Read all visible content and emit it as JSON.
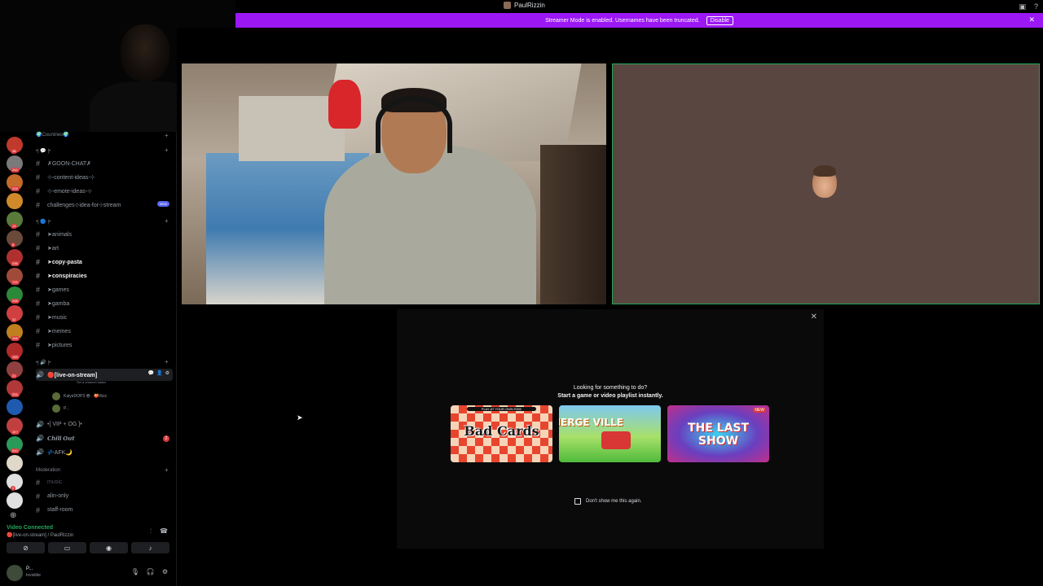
{
  "titlebar": {
    "title": "PaulRizzin"
  },
  "banner": {
    "message": "Streamer Mode is enabled. Usernames have been truncated.",
    "disable_label": "Disable",
    "close_icon": "✕"
  },
  "rail": {
    "servers": [
      {
        "color": "#c0392b",
        "badge": "38"
      },
      {
        "color": "#7a7a7a",
        "badge": "262"
      },
      {
        "color": "#c46a2b",
        "badge": "205"
      },
      {
        "color": "#d08a2a",
        "badge": ""
      },
      {
        "color": "#5a7a3a",
        "badge": "13"
      },
      {
        "color": "#6a4a3a",
        "badge": "8"
      },
      {
        "color": "#b03030",
        "badge": "236"
      },
      {
        "color": "#a04a3a",
        "badge": "729"
      },
      {
        "color": "#2a8a3a",
        "badge": "298"
      },
      {
        "color": "#d04040",
        "badge": "32"
      },
      {
        "color": "#c08020",
        "badge": "398"
      },
      {
        "color": "#b02a2a",
        "badge": "159"
      },
      {
        "color": "#904040",
        "badge": "21"
      },
      {
        "color": "#b03838",
        "badge": "254"
      },
      {
        "color": "#1e5ab0",
        "badge": ""
      },
      {
        "color": "#c04040",
        "badge": "1K+"
      },
      {
        "color": "#2a9a5a",
        "badge": "810"
      },
      {
        "color": "#e0d8c8",
        "badge": ""
      },
      {
        "color": "#e0e0e0",
        "badge": "3"
      },
      {
        "color": "#e0e0e0",
        "badge": ""
      }
    ]
  },
  "sidebar": {
    "categories": {
      "countries": "🌍Countries🌍",
      "chat": "•| 💬 |•",
      "general": "•| 🔵 |•",
      "voice": "•| 🔊 |•",
      "moderation": "Moderation"
    },
    "text_channels": [
      {
        "name": "✗GOON-CHAT✗"
      },
      {
        "name": "⊹-content-ideas-⊹"
      },
      {
        "name": "⊹-emote-ideas-⊹"
      },
      {
        "name": "challenges⊹idea-for⊹stream",
        "badge": "NEW"
      }
    ],
    "general_channels": [
      {
        "name": "➤animals",
        "bright": false
      },
      {
        "name": "➤art",
        "bright": false
      },
      {
        "name": "➤copy-pasta",
        "bright": true
      },
      {
        "name": "➤conspiracies",
        "bright": true
      },
      {
        "name": "➤games",
        "bright": false
      },
      {
        "name": "➤gamba",
        "bright": false
      },
      {
        "name": "➤music",
        "bright": false
      },
      {
        "name": "➤memes",
        "bright": false
      },
      {
        "name": "➤pictures",
        "bright": false
      }
    ],
    "voice_channels": {
      "live": "🔴[live-on-stream]",
      "live_status": "Set a channel status",
      "users": [
        "KalyeDOP3 😎 · 🍑Rizz",
        "P..."
      ],
      "vip": "•[ VIP + OG ]•",
      "chill": "𝘾𝙝𝙞𝙡𝙡 𝙊𝙪𝙩",
      "chill_count": "2",
      "afk": "💤AFK🌙"
    },
    "moderation_channels": [
      "music",
      "alin-only",
      "staff-room"
    ]
  },
  "voice_panel": {
    "status": "Video Connected",
    "channel": "🔴[live-on-stream] / PaulRizzin"
  },
  "user_panel": {
    "name": "P...",
    "status": "Invisible"
  },
  "activity_shelf": {
    "title": "Looking for something to do?",
    "subtitle": "Start a game or video playlist instantly.",
    "games": [
      {
        "name": "Bad Cards",
        "tag": "PLAY AT YOUR OWN RISK"
      },
      {
        "name": "MERGE VILLE"
      },
      {
        "name": "THE LAST SHOW",
        "badge": "NEW"
      }
    ],
    "dont_show": "Don't show me this again."
  },
  "colors": {
    "banner": "#9b18f5",
    "connected": "#23a55a",
    "avatar_tile": "#594640"
  }
}
